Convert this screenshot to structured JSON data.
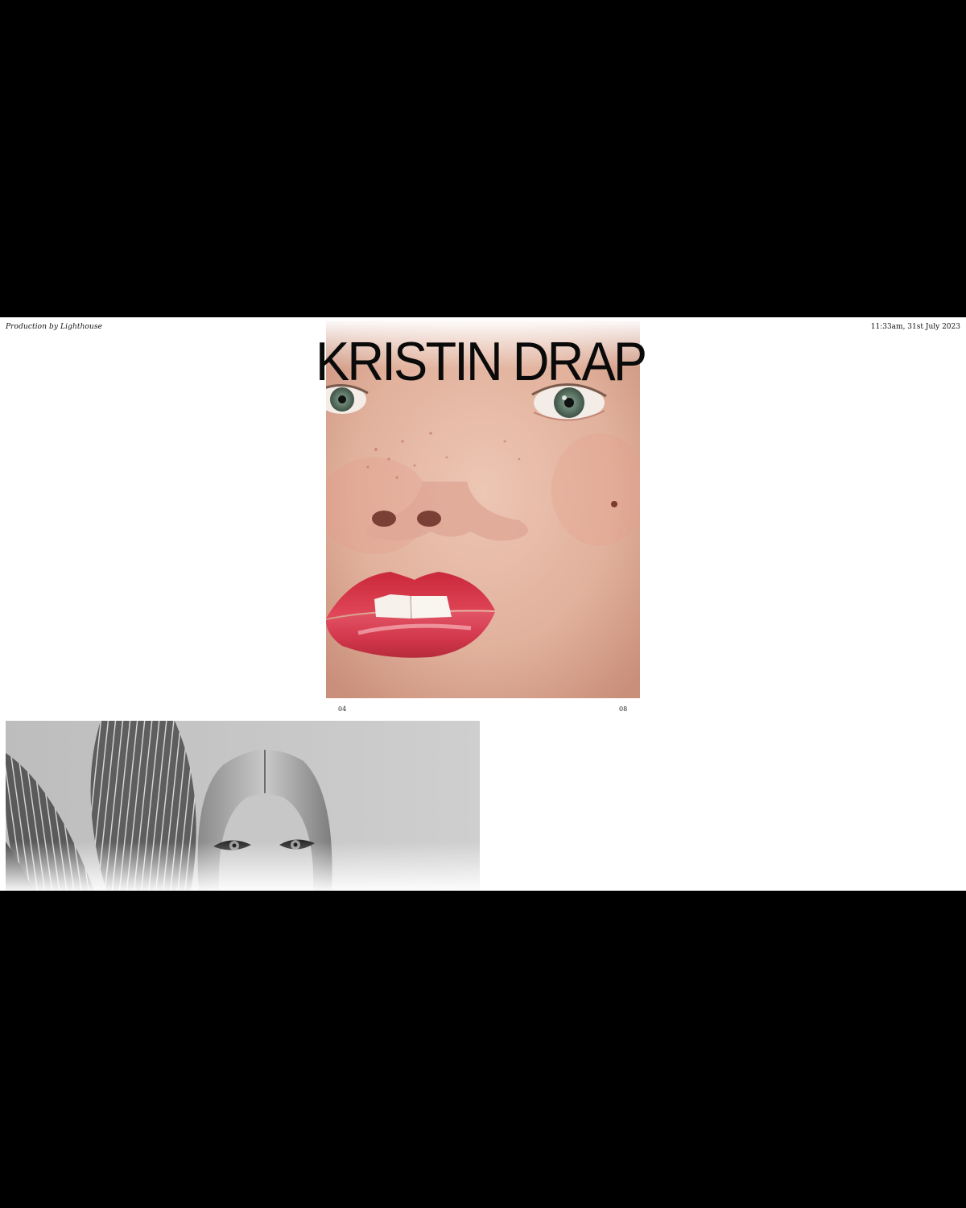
{
  "header": {
    "credit": "Production by Lighthouse",
    "datetime": "11:33am, 31st July 2023",
    "menu_icon": "hamburger-icon"
  },
  "hero": {
    "title": "KRISTIN DRAP",
    "image_subject": "close-up color portrait with red lips",
    "counter_current": "04",
    "counter_total": "08"
  },
  "gallery": {
    "image_subject": "black and white portrait with leaves"
  },
  "colors": {
    "page_background": "#ffffff",
    "frame": "#000000",
    "text": "#111111"
  }
}
